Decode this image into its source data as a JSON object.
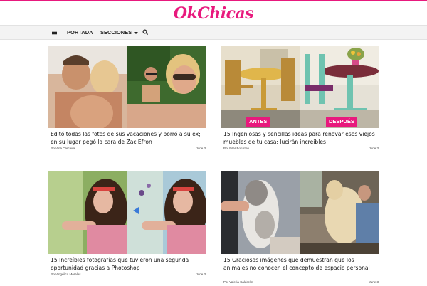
{
  "theme": {
    "brand": "#e8197d",
    "nav_bg": "#f3f3f3"
  },
  "site": {
    "logo_text": "OkChicas"
  },
  "nav": {
    "menu_icon": "hamburger-menu-icon",
    "portada": "PORTADA",
    "secciones": "SECCIONES",
    "search_icon": "search-icon"
  },
  "articles": [
    {
      "title": "Editó todas las fotos de sus vacaciones y borró a su ex; en su lugar pegó la cara de Zac Efron",
      "author": "Por Ana Carceira",
      "date": "June 3"
    },
    {
      "title": "15 Ingeniosas y sencillas ideas para renovar esos viejos muebles de tu casa; lucirán increíbles",
      "author": "Por Pilar Borurren",
      "date": "June 3",
      "badge_before": "ANTES",
      "badge_after": "DESPUÉS"
    },
    {
      "title": "15 Increíbles fotografías que tuvieron una segunda oportunidad gracias a Photoshop",
      "author": "Por Angelica Morales",
      "date": "June 3"
    },
    {
      "title": "15 Graciosas imágenes que demuestran que los animales no conocen el concepto de espacio personal",
      "author": "Por Valeria Calderón",
      "date": "June 3"
    }
  ]
}
